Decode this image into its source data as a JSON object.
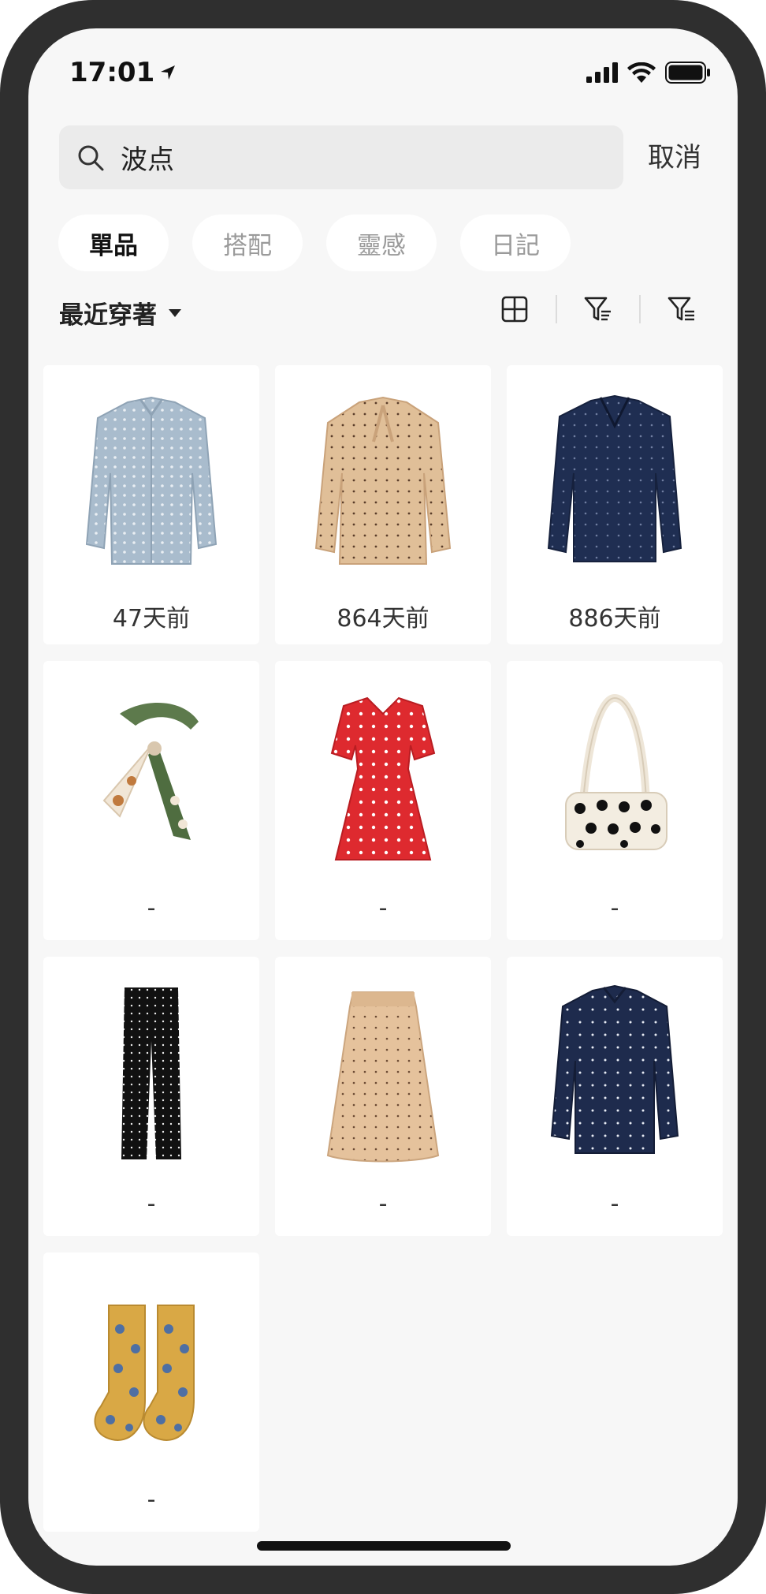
{
  "status_bar": {
    "time": "17:01"
  },
  "search": {
    "value": "波点",
    "cancel_label": "取消"
  },
  "tabs": [
    {
      "label": "單品",
      "active": true
    },
    {
      "label": "搭配",
      "active": false
    },
    {
      "label": "靈感",
      "active": false
    },
    {
      "label": "日記",
      "active": false
    }
  ],
  "sort": {
    "label": "最近穿著"
  },
  "items": [
    {
      "caption": "47天前",
      "icon": "blue-polka-dot-shirt-icon"
    },
    {
      "caption": "864天前",
      "icon": "beige-polka-dot-blouse-icon"
    },
    {
      "caption": "886天前",
      "icon": "navy-polka-dot-shirt-icon"
    },
    {
      "caption": "-",
      "icon": "polka-dot-scarf-icon"
    },
    {
      "caption": "-",
      "icon": "red-polka-dot-dress-icon"
    },
    {
      "caption": "-",
      "icon": "polka-dot-handbag-icon"
    },
    {
      "caption": "-",
      "icon": "black-polka-dot-trousers-icon"
    },
    {
      "caption": "-",
      "icon": "beige-polka-dot-skirt-icon"
    },
    {
      "caption": "-",
      "icon": "navy-polka-dot-blouse-icon"
    },
    {
      "caption": "-",
      "icon": "yellow-polka-dot-socks-icon"
    }
  ],
  "colors": {
    "background": "#f7f7f7",
    "frame": "#2f2f2f",
    "search_bg": "#ebebeb"
  }
}
